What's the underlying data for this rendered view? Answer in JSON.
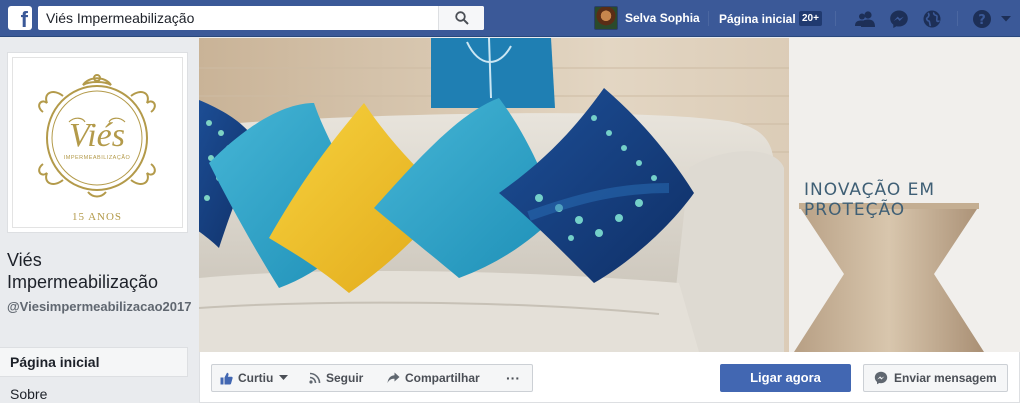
{
  "search": {
    "value": "Viés Impermeabilização"
  },
  "topbar": {
    "user_name": "Selva Sophia",
    "home_label": "Página inicial",
    "home_badge": "20+"
  },
  "page": {
    "logo_text": "Viés",
    "logo_subtext": "IMPERMEABILIZAÇÃO",
    "logo_years": "15 ANOS",
    "name": "Viés Impermeabilização",
    "handle": "@Viesimpermeabilizacao2017"
  },
  "nav": {
    "items": [
      "Página inicial",
      "Sobre"
    ]
  },
  "cover": {
    "caption": "INOVAÇÃO EM PROTEÇÃO"
  },
  "actions": {
    "like_label": "Curtiu",
    "follow_label": "Seguir",
    "share_label": "Compartilhar",
    "more_label": "···",
    "call_label": "Ligar agora",
    "message_label": "Enviar mensagem"
  },
  "colors": {
    "brand": "#3b5998",
    "primary_button": "#4267b2",
    "logo_gold": "#b39a4a"
  }
}
